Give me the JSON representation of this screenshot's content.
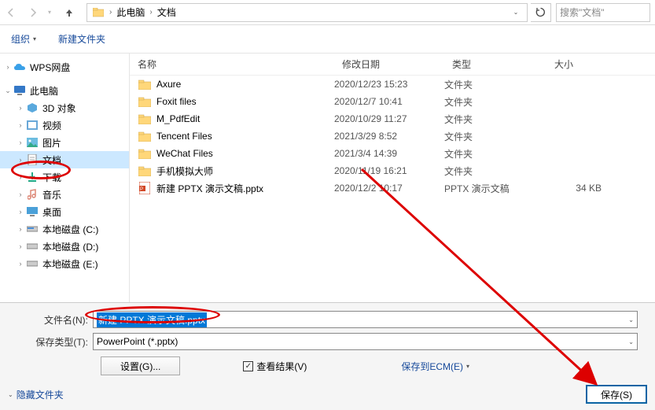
{
  "breadcrumb": {
    "root": "此电脑",
    "current": "文档"
  },
  "search": {
    "placeholder": "搜索\"文档\""
  },
  "toolbar": {
    "organize": "组织",
    "newfolder": "新建文件夹"
  },
  "sidebar": {
    "wps": "WPS网盘",
    "thispc": "此电脑",
    "items": [
      "3D 对象",
      "视频",
      "图片",
      "文档",
      "下载",
      "音乐",
      "桌面",
      "本地磁盘 (C:)",
      "本地磁盘 (D:)",
      "本地磁盘 (E:)"
    ]
  },
  "columns": {
    "name": "名称",
    "date": "修改日期",
    "type": "类型",
    "size": "大小"
  },
  "files": [
    {
      "name": "Axure",
      "date": "2020/12/23 15:23",
      "type": "文件夹",
      "size": "",
      "kind": "folder"
    },
    {
      "name": "Foxit files",
      "date": "2020/12/7 10:41",
      "type": "文件夹",
      "size": "",
      "kind": "folder"
    },
    {
      "name": "M_PdfEdit",
      "date": "2020/10/29 11:27",
      "type": "文件夹",
      "size": "",
      "kind": "folder"
    },
    {
      "name": "Tencent Files",
      "date": "2021/3/29 8:52",
      "type": "文件夹",
      "size": "",
      "kind": "folder"
    },
    {
      "name": "WeChat Files",
      "date": "2021/3/4 14:39",
      "type": "文件夹",
      "size": "",
      "kind": "folder"
    },
    {
      "name": "手机模拟大师",
      "date": "2020/11/19 16:21",
      "type": "文件夹",
      "size": "",
      "kind": "folder"
    },
    {
      "name": "新建 PPTX 演示文稿.pptx",
      "date": "2020/12/2 10:17",
      "type": "PPTX 演示文稿",
      "size": "34 KB",
      "kind": "pptx"
    }
  ],
  "form": {
    "filename_label": "文件名(N):",
    "filename_value": "新建 PPTX 演示文稿.pptx",
    "savetype_label": "保存类型(T):",
    "savetype_value": "PowerPoint (*.pptx)",
    "settings_btn": "设置(G)...",
    "view_result": "查看结果(V)",
    "save_ecm": "保存到ECM(E)",
    "hide_folders": "隐藏文件夹",
    "save_btn": "保存(S)"
  }
}
